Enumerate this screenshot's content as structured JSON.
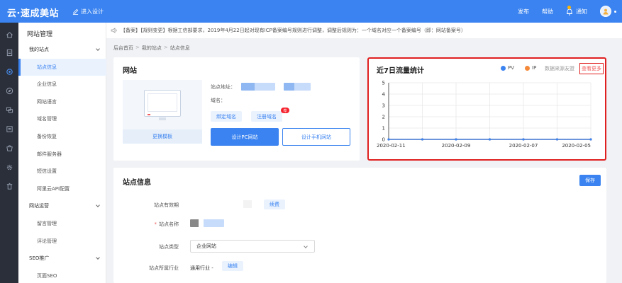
{
  "app": {
    "logo": "云·速成美站",
    "enter_design": "进入设计"
  },
  "topnav": {
    "publish": "发布",
    "help": "帮助",
    "notify": "通知"
  },
  "sidebar": {
    "title": "网站管理",
    "items": [
      {
        "label": "我的站点",
        "type": "group"
      },
      {
        "label": "站点信息",
        "type": "sub",
        "active": true
      },
      {
        "label": "企业信息",
        "type": "sub"
      },
      {
        "label": "网站语言",
        "type": "sub"
      },
      {
        "label": "域名管理",
        "type": "sub"
      },
      {
        "label": "备份恢复",
        "type": "sub"
      },
      {
        "label": "邮件服务器",
        "type": "sub"
      },
      {
        "label": "短信设置",
        "type": "sub"
      },
      {
        "label": "阿里云API配置",
        "type": "sub"
      },
      {
        "label": "网站运营",
        "type": "group"
      },
      {
        "label": "留言管理",
        "type": "sub"
      },
      {
        "label": "评论管理",
        "type": "sub"
      },
      {
        "label": "SEO推广",
        "type": "group"
      },
      {
        "label": "页面SEO",
        "type": "sub"
      }
    ]
  },
  "notice": "【备案】【规则变更】根据工信部要求，2019年4月22日起对现有ICP备案编号规则进行调整，调整后规则为：一个域名对应一个备案编号（即：网站备案号）",
  "breadcrumb": [
    "后台首页",
    "我的站点",
    "站点信息"
  ],
  "website_card": {
    "title": "网站",
    "change_template": "更换模板",
    "site_address_label": "站点地址：",
    "domain_label": "域名：",
    "bind_domain": "绑定域名",
    "register_domain": "注册域名",
    "badge": "荐",
    "design_pc": "设计PC网站",
    "design_mobile": "设计手机网站"
  },
  "traffic_card": {
    "title": "近7日流量统计",
    "legend_pv": "PV",
    "legend_ip": "IP",
    "source_note": "数据来源友盟",
    "see_more": "查看更多",
    "pv_color": "#3a83f0",
    "ip_color": "#f5893a"
  },
  "chart_data": {
    "type": "line",
    "x": [
      "2020-02-11",
      "2020-02-10",
      "2020-02-09",
      "2020-02-08",
      "2020-02-07",
      "2020-02-06",
      "2020-02-05"
    ],
    "x_tick_labels": [
      "2020-02-11",
      "2020-02-09",
      "2020-02-07",
      "2020-02-05"
    ],
    "ylim": [
      0,
      5
    ],
    "y_ticks": [
      0,
      1,
      2,
      3,
      4,
      5
    ],
    "series": [
      {
        "name": "PV",
        "values": [
          0,
          0,
          0,
          0,
          0,
          0,
          0
        ]
      },
      {
        "name": "IP",
        "values": [
          0,
          0,
          0,
          0,
          0,
          0,
          0
        ]
      }
    ],
    "legend": "top-right"
  },
  "site_info_card": {
    "title": "站点信息",
    "save": "保存",
    "validity_label": "站点有效期",
    "renew": "续费",
    "name_label": "站点名称",
    "type_label": "站点类型",
    "type_value": "企业网站",
    "industry_label": "站点所属行业",
    "industry_value": "通用行业 -",
    "edit": "编辑"
  }
}
